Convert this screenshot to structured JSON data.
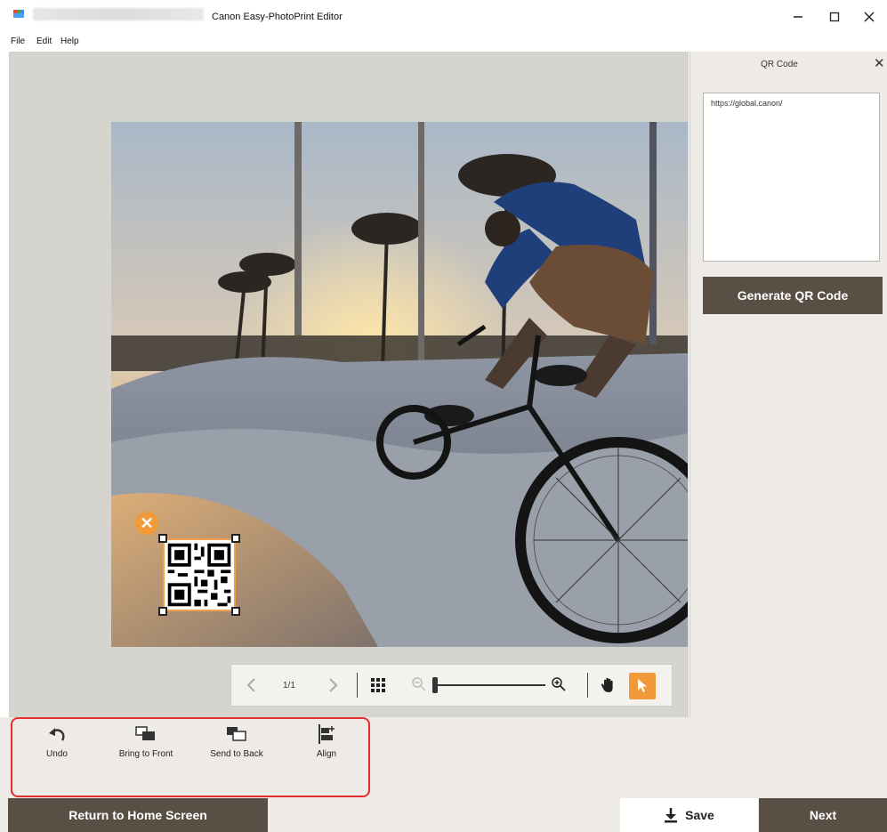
{
  "window": {
    "title": "Canon Easy-PhotoPrint Editor",
    "minimize_icon": "minimize-icon",
    "maximize_icon": "maximize-icon",
    "close_icon": "close-icon"
  },
  "menu": {
    "items": [
      "File",
      "Edit",
      "Help"
    ]
  },
  "panel": {
    "title": "QR Code",
    "close_label": "✕",
    "url_value": "https://global.canon/",
    "generate_label": "Generate QR Code"
  },
  "canvas": {
    "qr_delete_label": "✕"
  },
  "navigation": {
    "page_indicator": "1/1",
    "prev_icon": "chevron-left-icon",
    "next_icon": "chevron-right-icon",
    "grid_icon": "grid-icon",
    "zoom_out_icon": "zoom-out-icon",
    "zoom_in_icon": "zoom-in-icon",
    "zoom_level": 0.0,
    "hand_icon": "hand-icon",
    "pointer_icon": "pointer-icon"
  },
  "tools": [
    {
      "label": "Undo",
      "icon": "undo-icon"
    },
    {
      "label": "Bring to Front",
      "icon": "bring-to-front-icon"
    },
    {
      "label": "Send to Back",
      "icon": "send-to-back-icon"
    },
    {
      "label": "Align",
      "icon": "align-icon"
    }
  ],
  "footer": {
    "return_label": "Return to Home Screen",
    "save_label": "Save",
    "next_label": "Next"
  },
  "colors": {
    "accent_orange": "#f29a3a",
    "dark_button": "#5a4f45",
    "panel_bg": "#eeebe7",
    "highlight_red": "#e42e2e"
  }
}
